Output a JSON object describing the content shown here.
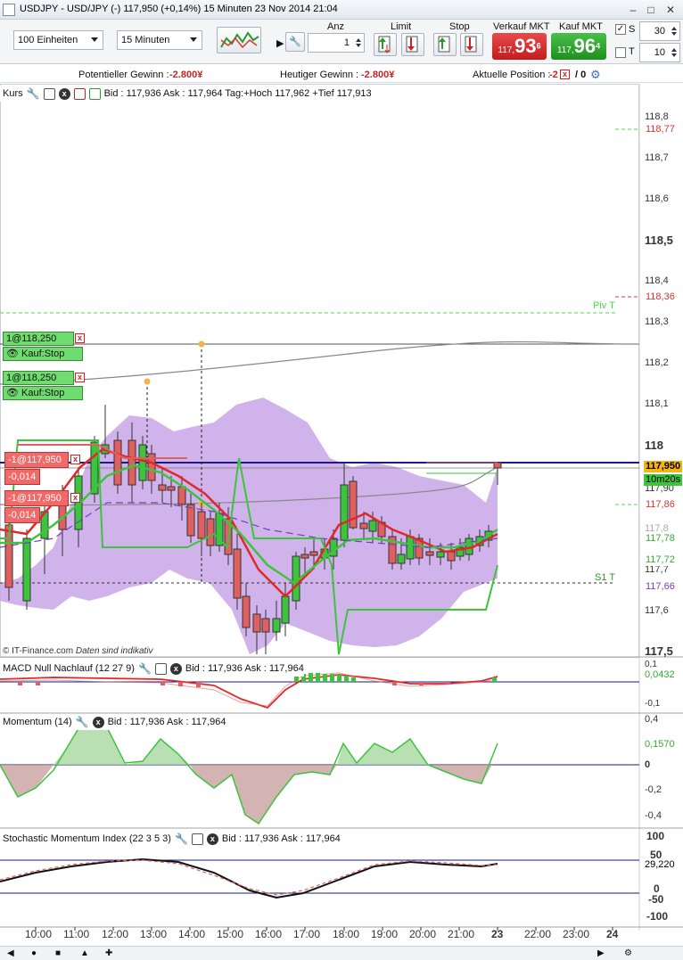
{
  "window": {
    "title": "USDJPY - USD/JPY (-)    117,950 (+0,14%)    15 Minuten  23 Nov 2014 21:04"
  },
  "toolbar": {
    "units_select": "100 Einheiten",
    "interval_select": "15 Minuten",
    "anz_label": "Anz",
    "anz_value": "1",
    "limit_label": "Limit",
    "stop_label": "Stop",
    "sell_label": "Verkauf MKT",
    "sell_small": "117,",
    "sell_big": "93",
    "sell_sup": "6",
    "buy_label": "Kauf MKT",
    "buy_small": "117,",
    "buy_big": "96",
    "buy_sup": "4",
    "s_label": "S",
    "s_value": "30",
    "t_label": "T",
    "t_value": "10"
  },
  "infobar": {
    "pot_label": "Potentieller Gewinn :",
    "pot_value": "-2.800¥",
    "today_label": "Heutiger Gewinn :",
    "today_value": "-2.800¥",
    "pos_label": "Aktuelle Position :",
    "pos_value": "-2",
    "pos_sep": "/ 0"
  },
  "price_panel": {
    "title": "Kurs",
    "info": "Bid : 117,936  Ask : 117,964  Tag:+Hoch 117,962 +Tief 117,913",
    "copyright": "© IT-Finance.com",
    "disclaimer": "Daten sind indikativ",
    "axis": [
      "118,8",
      "118,7",
      "118,6",
      "118,5",
      "118,4",
      "118,3",
      "118,2",
      "118,1",
      "118",
      "117,90",
      "117,8",
      "117,7",
      "117,6",
      "117,5"
    ],
    "tags": {
      "r1": "118,77",
      "r2": "118,36",
      "price": "117,950",
      "timer": "10m20s",
      "r3": "117,86",
      "g1": "117,78",
      "g2": "117,72",
      "p1": "117,66"
    },
    "piv_label": "Piv T",
    "s1_label": "S1 T",
    "orders": [
      {
        "qty": "1@118,250",
        "type": "Kauf:Stop"
      },
      {
        "qty": "1@118,250",
        "type": "Kauf:Stop"
      }
    ],
    "positions": [
      {
        "qty": "-1@117,950",
        "pnl": "-0,014"
      },
      {
        "qty": "-1@117,950",
        "pnl": "-0,014"
      }
    ]
  },
  "macd_panel": {
    "title": "MACD Null Nachlauf (12 27 9)",
    "info": "Bid : 117,936  Ask : 117,964",
    "axis_top": "0,1",
    "axis_bottom": "-0,1",
    "value": "0,0432"
  },
  "mom_panel": {
    "title": "Momentum (14)",
    "info": "Bid : 117,936  Ask : 117,964",
    "axis": [
      "0,4",
      "0,2",
      "0",
      "-0,2",
      "-0,4"
    ],
    "value": "0,1570"
  },
  "smi_panel": {
    "title": "Stochastic Momentum Index (22 3 5 3)",
    "info": "Bid : 117,936  Ask : 117,964",
    "axis": [
      "100",
      "50",
      "0",
      "-50",
      "-100"
    ],
    "value": "29,220"
  },
  "time_axis": [
    "10:00",
    "11:00",
    "12:00",
    "13:00",
    "14:00",
    "15:00",
    "16:00",
    "17:00",
    "18:00",
    "19:00",
    "20:00",
    "21:00",
    "23",
    "22:00",
    "23:00",
    "24"
  ],
  "colors": {
    "bull": "#3cc43c",
    "bear": "#e06060",
    "band": "#c9a6e8",
    "sell": "#d42a2a",
    "buy": "#2ca02c"
  }
}
